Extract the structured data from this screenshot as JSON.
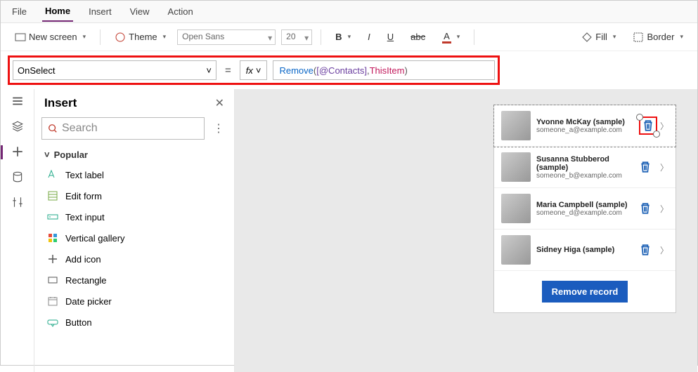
{
  "menu": {
    "file": "File",
    "home": "Home",
    "insert": "Insert",
    "view": "View",
    "action": "Action"
  },
  "toolbar": {
    "newScreen": "New screen",
    "theme": "Theme",
    "font": "Open Sans",
    "fontSize": "20",
    "fill": "Fill",
    "border": "Border"
  },
  "formula": {
    "property": "OnSelect",
    "fx": "fx",
    "fn": "Remove",
    "open": "( ",
    "ds": "[@Contacts]",
    "comma": ", ",
    "kw": "ThisItem",
    "close": " )"
  },
  "insertPanel": {
    "title": "Insert",
    "searchPlaceholder": "Search",
    "section": "Popular",
    "items": [
      "Text label",
      "Edit form",
      "Text input",
      "Vertical gallery",
      "Add icon",
      "Rectangle",
      "Date picker",
      "Button"
    ]
  },
  "gallery": {
    "rows": [
      {
        "name": "Yvonne McKay (sample)",
        "email": "someone_a@example.com"
      },
      {
        "name": "Susanna Stubberod (sample)",
        "email": "someone_b@example.com"
      },
      {
        "name": "Maria Campbell (sample)",
        "email": "someone_d@example.com"
      },
      {
        "name": "Sidney Higa (sample)",
        "email": ""
      }
    ],
    "button": "Remove record"
  }
}
